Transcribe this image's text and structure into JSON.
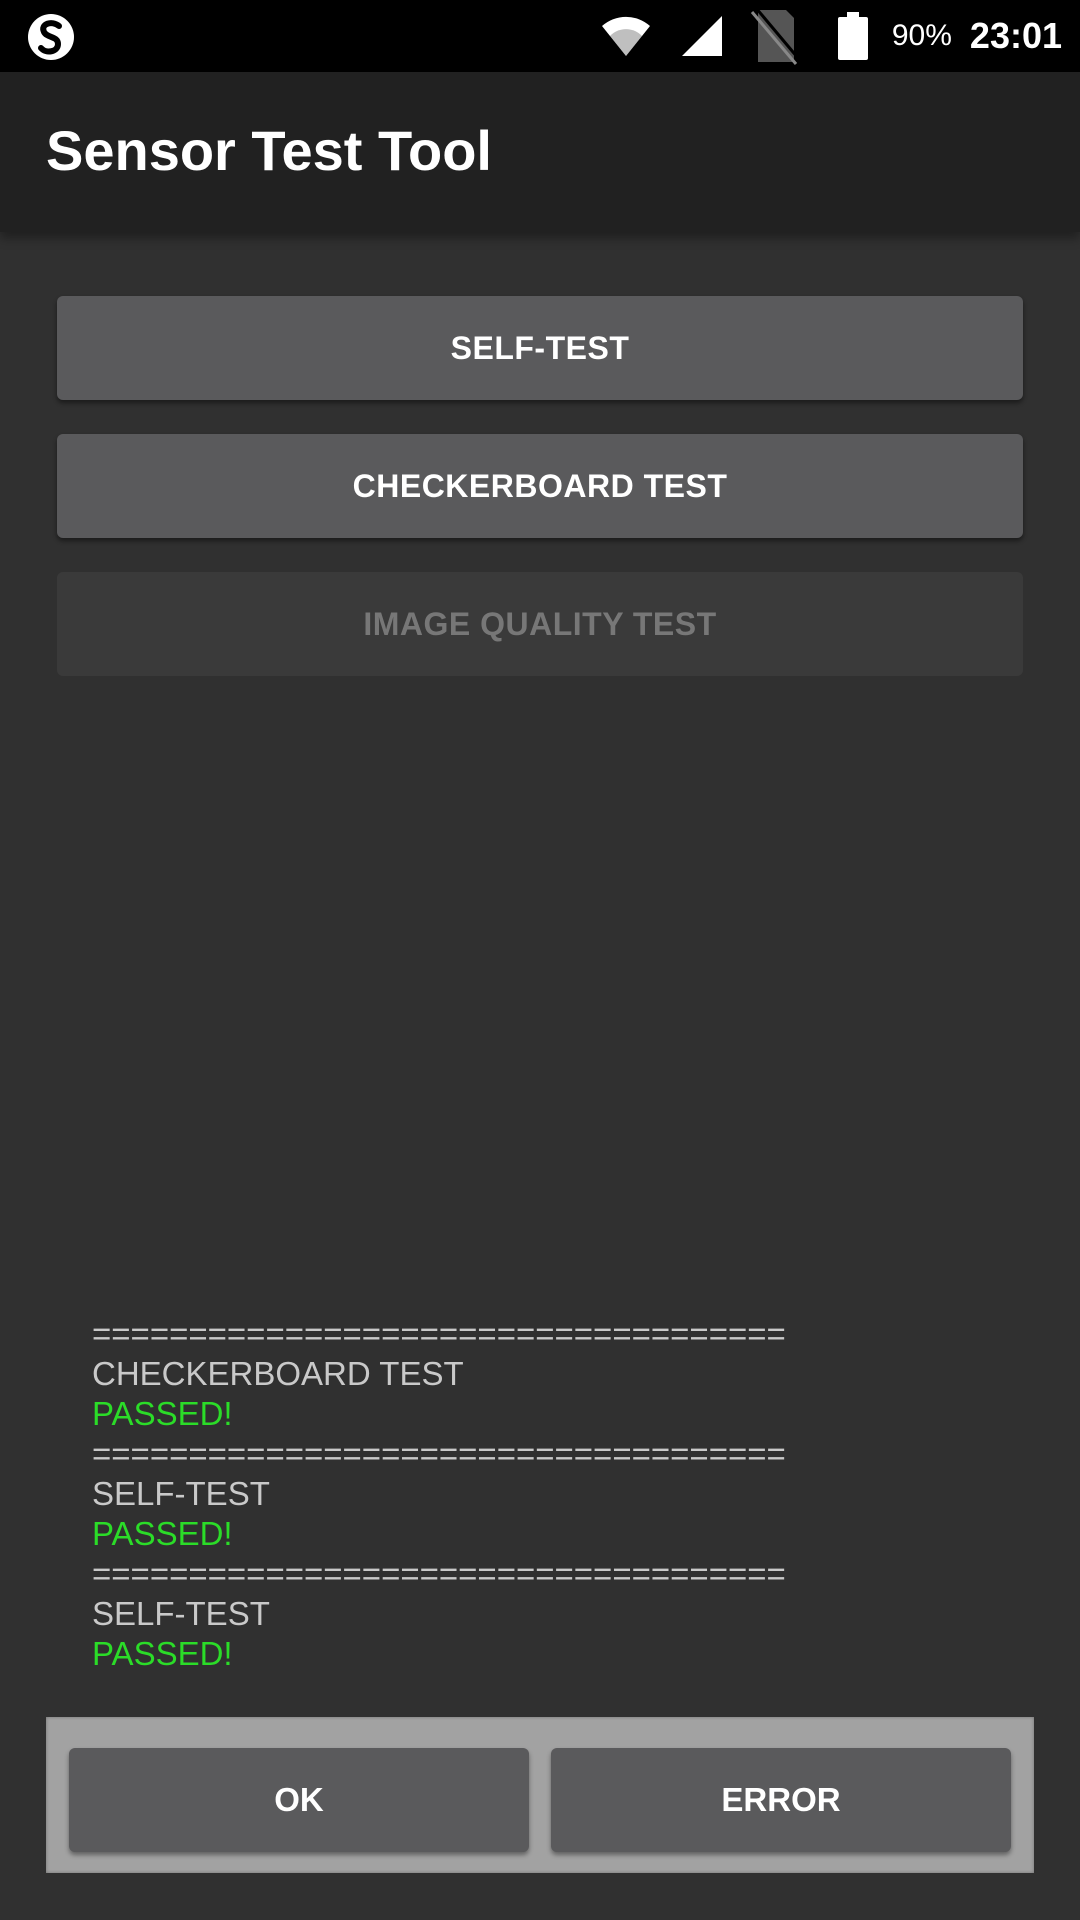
{
  "status_bar": {
    "battery_percent": "90%",
    "time": "23:01",
    "icons": [
      "app-notification-icon",
      "wifi-icon",
      "cell-signal-icon",
      "no-sim-icon",
      "battery-icon"
    ]
  },
  "app_bar": {
    "title": "Sensor Test Tool"
  },
  "buttons": {
    "self_test": "SELF-TEST",
    "checkerboard_test": "CHECKERBOARD TEST",
    "image_quality_test": "IMAGE QUALITY TEST"
  },
  "log": [
    {
      "separator": "====================================",
      "name": "CHECKERBOARD TEST",
      "result": "PASSED!"
    },
    {
      "separator": "====================================",
      "name": "SELF-TEST",
      "result": "PASSED!"
    },
    {
      "separator": "====================================",
      "name": "SELF-TEST",
      "result": "PASSED!"
    }
  ],
  "bottom_panel": {
    "ok_label": "OK",
    "error_label": "ERROR"
  },
  "colors": {
    "status_bar": "#000000",
    "app_bar": "#212121",
    "background": "#303030",
    "button": "#5a5a5c",
    "pass_green": "#2bdc28",
    "panel": "#a2a2a2"
  }
}
